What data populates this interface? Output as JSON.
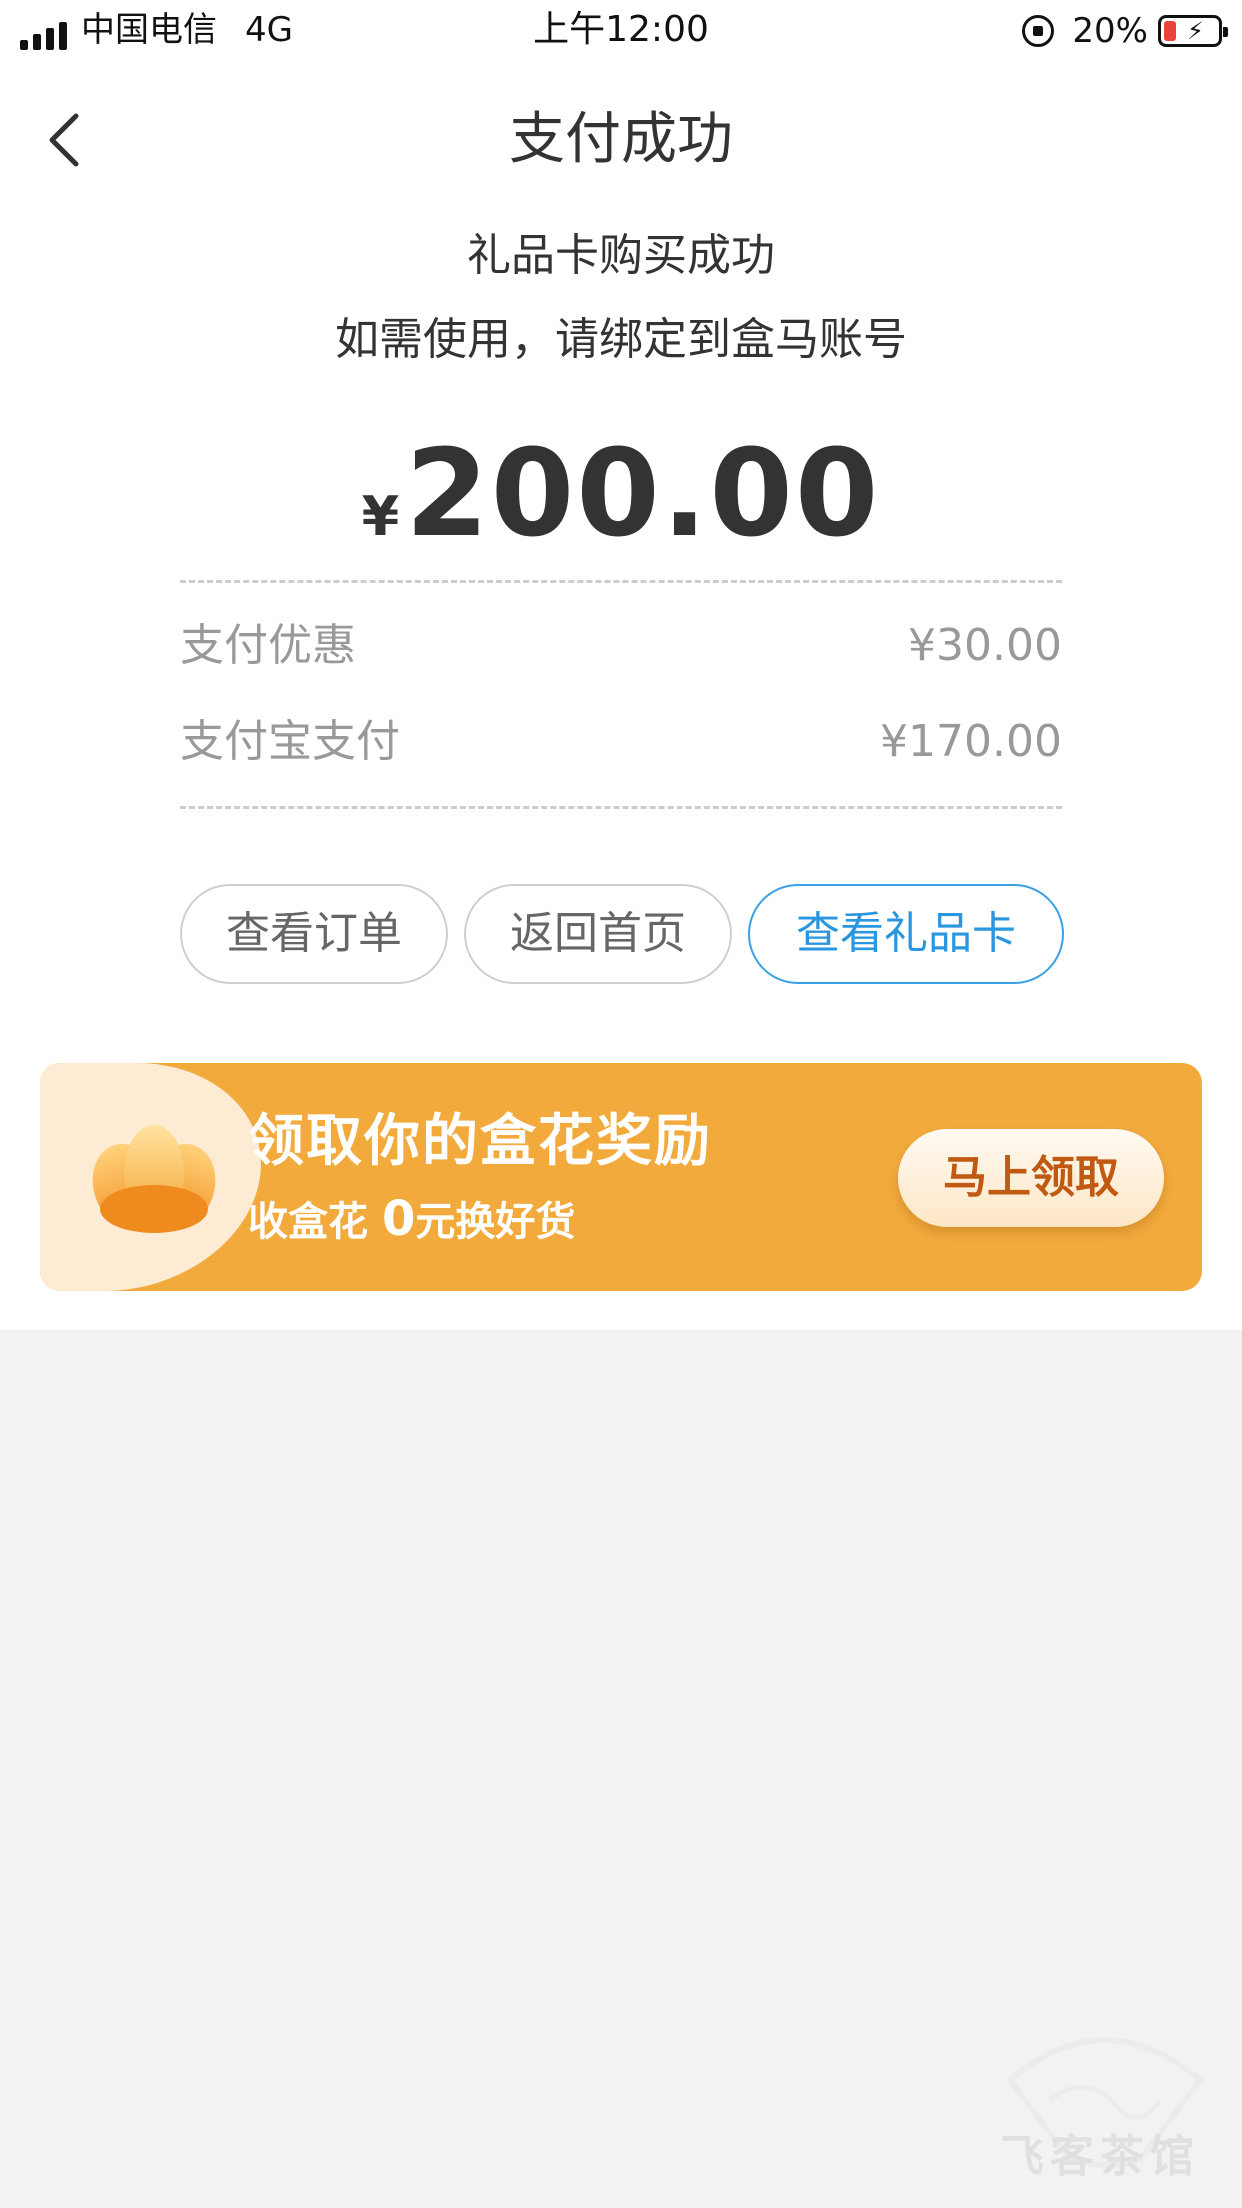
{
  "status_bar": {
    "carrier": "中国电信",
    "network": "4G",
    "time": "上午12:00",
    "battery_percent": "20%"
  },
  "nav": {
    "title": "支付成功"
  },
  "result": {
    "line1": "礼品卡购买成功",
    "line2": "如需使用，请绑定到盒马账号",
    "currency_symbol": "¥",
    "amount": "200.00"
  },
  "payment_details": [
    {
      "label": "支付优惠",
      "value": "¥30.00"
    },
    {
      "label": "支付宝支付",
      "value": "¥170.00"
    }
  ],
  "actions": {
    "view_order": "查看订单",
    "back_home": "返回首页",
    "view_gift_card": "查看礼品卡"
  },
  "promo": {
    "title": "领取你的盒花奖励",
    "subtitle_prefix": "收盒花 ",
    "subtitle_number": "0",
    "subtitle_suffix": "元换好货",
    "claim_label": "马上领取"
  },
  "watermark": {
    "text": "飞客茶馆"
  },
  "colors": {
    "accent_blue": "#2b96e0",
    "banner_orange": "#f2aa3d",
    "battery_low": "#e8443a"
  }
}
